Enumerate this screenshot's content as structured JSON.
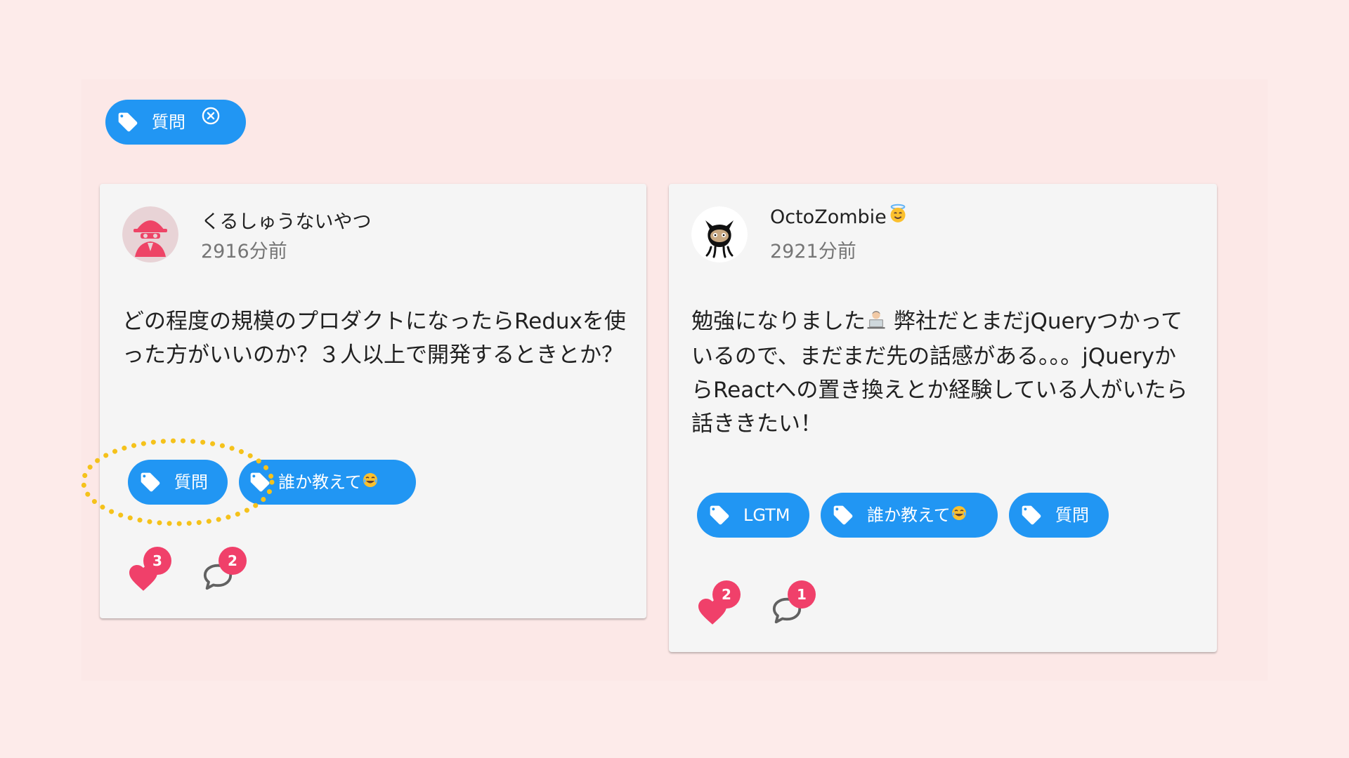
{
  "filter": {
    "label": "質問"
  },
  "colors": {
    "background": "#fdebea",
    "card": "#f5f5f5",
    "chip": "#2196f3",
    "badge": "#f0406a",
    "heart": "#f0406a",
    "highlight": "#f5c21b"
  },
  "posts": [
    {
      "user": "くるしゅうないやつ",
      "time": "2916分前",
      "avatar_icon": "spy-avatar-icon",
      "body": "どの程度の規模のプロダクトになったらReduxを使った方がいいのか？３人以上で開発するときとか？",
      "tags": [
        {
          "label": "質問"
        },
        {
          "label": "誰か教えて",
          "emoji_icon": "tears-of-joy-emoji-icon"
        }
      ],
      "likes": "3",
      "comments": "2"
    },
    {
      "user": "OctoZombie",
      "user_emoji_icon": "halo-smile-emoji-icon",
      "time": "2921分前",
      "avatar_icon": "octocat-avatar-icon",
      "body_line1": "勉強になりました",
      "body_line1_emoji_icon": "laptop-person-emoji-icon",
      "body_rest": " 弊社だとまだjQueryつかっているので、まだまだ先の話感がある。。。jQueryからReactへの置き換えとか経験している人がいたら話ききたい！",
      "tags": [
        {
          "label": "LGTM"
        },
        {
          "label": "誰か教えて",
          "emoji_icon": "tears-of-joy-emoji-icon"
        },
        {
          "label": "質問"
        }
      ],
      "likes": "2",
      "comments": "1"
    }
  ]
}
